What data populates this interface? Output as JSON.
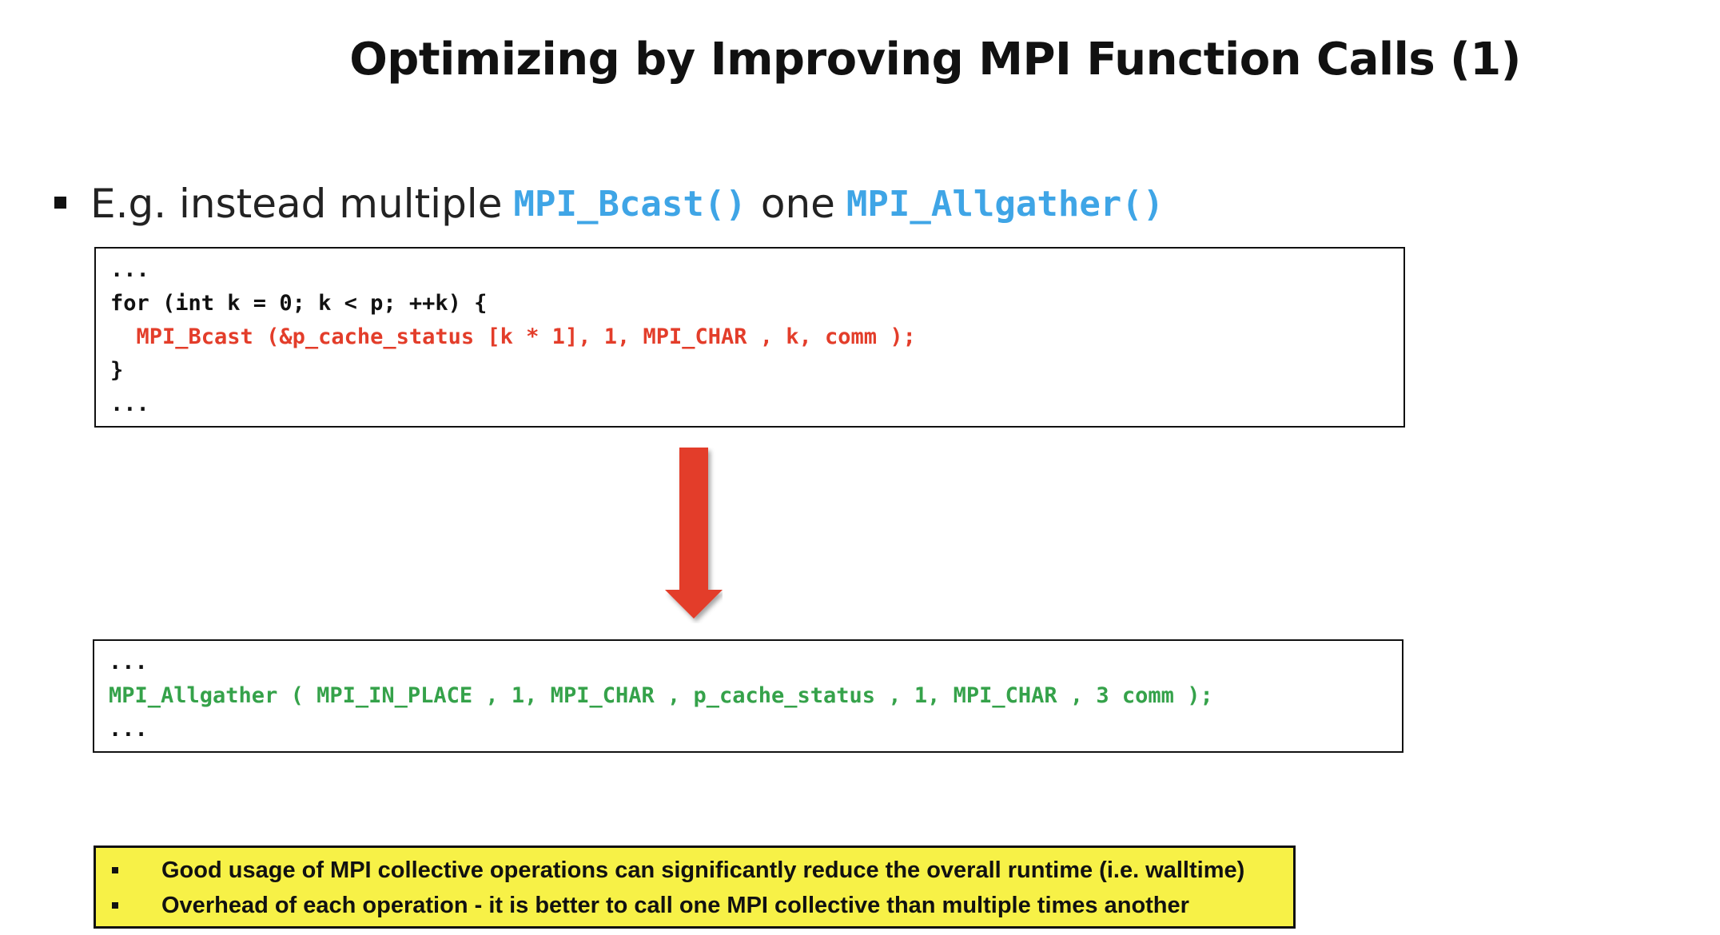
{
  "slide": {
    "title": "Optimizing by Improving MPI Function Calls (1)"
  },
  "bullet": {
    "prefix": "E.g. instead multiple",
    "code1": "MPI_Bcast()",
    "middle": "one",
    "code2": "MPI_Allgather()"
  },
  "code_before": {
    "lines": [
      "...",
      "for (int k = 0; k < p; ++k) {",
      "  MPI_Bcast (&p_cache_status [k * 1], 1, MPI_CHAR , k, comm );",
      "}",
      "..."
    ]
  },
  "code_after": {
    "lines": [
      "...",
      "MPI_Allgather ( MPI_IN_PLACE , 1, MPI_CHAR , p_cache_status , 1, MPI_CHAR , 3 comm );",
      "..."
    ]
  },
  "arrow": {
    "icon": "down-arrow-icon",
    "color": "#e33d2a"
  },
  "note": {
    "items": [
      "Good usage of MPI collective operations can significantly reduce the overall runtime (i.e. walltime)",
      "Overhead of each operation - it is better to call one MPI collective than multiple times another"
    ]
  },
  "colors": {
    "code_highlight": "#3fa5e6",
    "bcast_red": "#e33d2a",
    "allgather_green": "#35a24a",
    "note_background": "#f7f147"
  }
}
